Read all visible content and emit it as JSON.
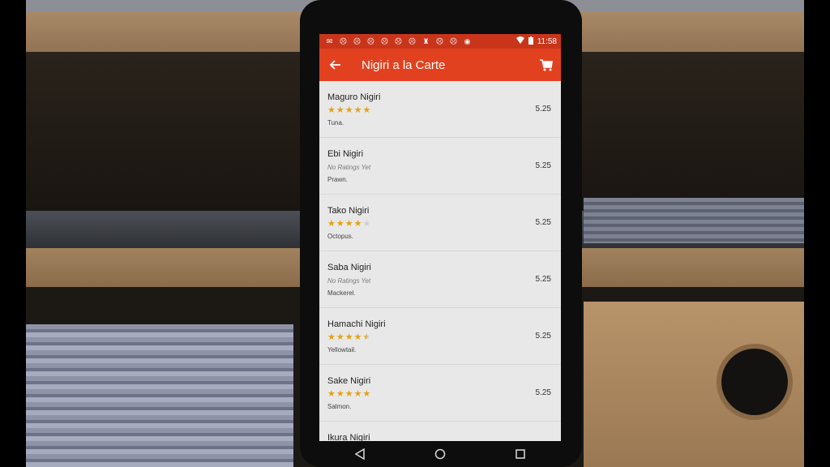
{
  "status_bar": {
    "notification_icons": [
      "message-icon",
      "alert-icon",
      "alert-icon",
      "alert-icon",
      "alert-icon",
      "alert-icon",
      "alert-icon",
      "chess-icon",
      "alert-icon",
      "alert-icon",
      "sync-icon"
    ],
    "time": "11:58"
  },
  "app_bar": {
    "title": "Nigiri a la Carte",
    "back_icon": "arrow-left-icon",
    "cart_icon": "cart-icon",
    "color": "#e2411f"
  },
  "items": [
    {
      "name": "Maguro Nigiri",
      "rating": 5,
      "rating_text": "",
      "description": "Tuna.",
      "price": "5.25"
    },
    {
      "name": "Ebi Nigiri",
      "rating": null,
      "rating_text": "No Ratings Yet",
      "description": "Prawn.",
      "price": "5.25"
    },
    {
      "name": "Tako Nigiri",
      "rating": 4,
      "rating_text": "",
      "description": "Octopus.",
      "price": "5.25"
    },
    {
      "name": "Saba Nigiri",
      "rating": null,
      "rating_text": "No Ratings Yet",
      "description": "Mackerel.",
      "price": "5.25"
    },
    {
      "name": "Hamachi Nigiri",
      "rating": 4.5,
      "rating_text": "",
      "description": "Yellowtail.",
      "price": "5.25"
    },
    {
      "name": "Sake Nigiri",
      "rating": 5,
      "rating_text": "",
      "description": "Salmon.",
      "price": "5.25"
    },
    {
      "name": "Ikura Nigiri",
      "rating": null,
      "rating_text": "",
      "description": "",
      "price": ""
    }
  ],
  "star_color": "#e6a00f",
  "nav_bar": {
    "back_icon": "triangle-back-icon",
    "home_icon": "circle-home-icon",
    "recents_icon": "square-recents-icon"
  }
}
